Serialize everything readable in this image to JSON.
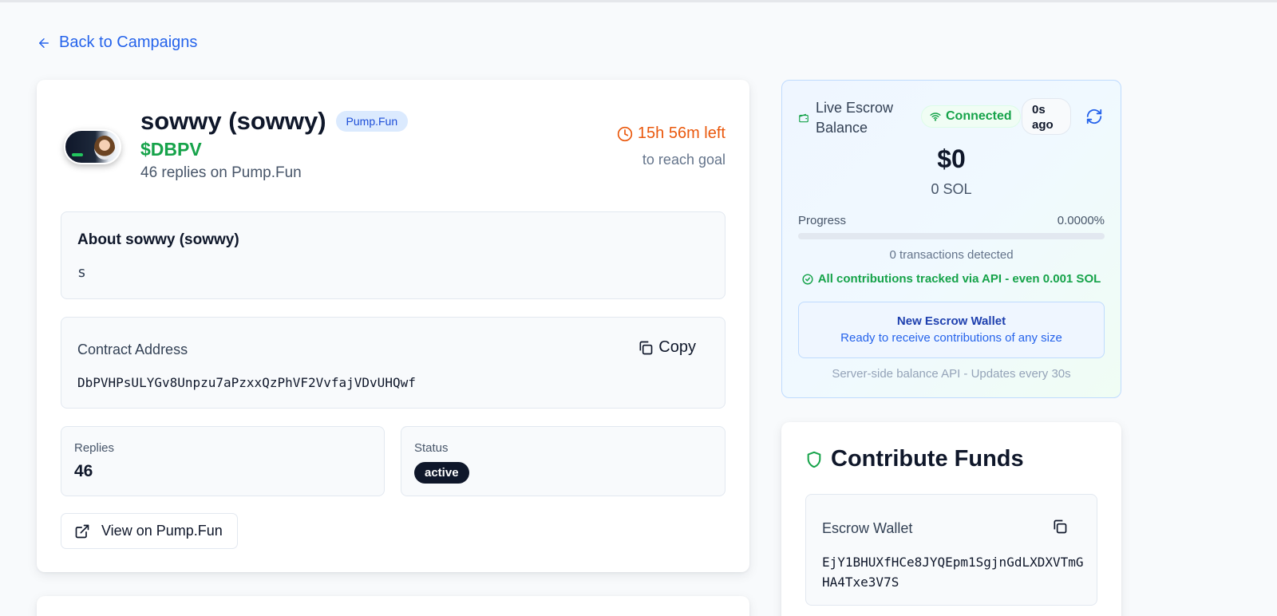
{
  "nav": {
    "back_label": "Back to Campaigns"
  },
  "campaign": {
    "title": "sowwy (sowwy)",
    "platform_badge": "Pump.Fun",
    "ticker": "$DBPV",
    "replies_line": "46 replies on Pump.Fun",
    "time_left": "15h 56m left",
    "goal_text": "to reach goal"
  },
  "about": {
    "heading": "About sowwy (sowwy)",
    "text": "s"
  },
  "contract": {
    "label": "Contract Address",
    "copy_label": "Copy",
    "address": "DbPVHPsULYGv8Unpzu7aPzxxQzPhVF2VvfajVDvUHQwf"
  },
  "stats": {
    "replies_label": "Replies",
    "replies_value": "46",
    "status_label": "Status",
    "status_value": "active"
  },
  "view_button_label": "View on Pump.Fun",
  "escrow": {
    "title": "Live Escrow Balance",
    "connection": "Connected",
    "updated": "0s ago",
    "usd": "$0",
    "sol": "0 SOL",
    "progress_label": "Progress",
    "progress_value": "0.0000%",
    "progress_fraction": 0,
    "transactions": "0 transactions detected",
    "tracked_note": "All contributions tracked via API - even 0.001 SOL",
    "new_wallet_title": "New Escrow Wallet",
    "new_wallet_sub": "Ready to receive contributions of any size",
    "server_note": "Server-side balance API - Updates every 30s"
  },
  "contribute": {
    "title": "Contribute Funds",
    "wallet_label": "Escrow Wallet",
    "wallet_address": "EjY1BHUXfHCe8JYQEpm1SgjnGdLXDXVTmGHA4Txe3V7S"
  },
  "colors": {
    "accent": "#2563eb",
    "success": "#16a34a",
    "warning": "#ea580c",
    "dark": "#0f172a"
  }
}
